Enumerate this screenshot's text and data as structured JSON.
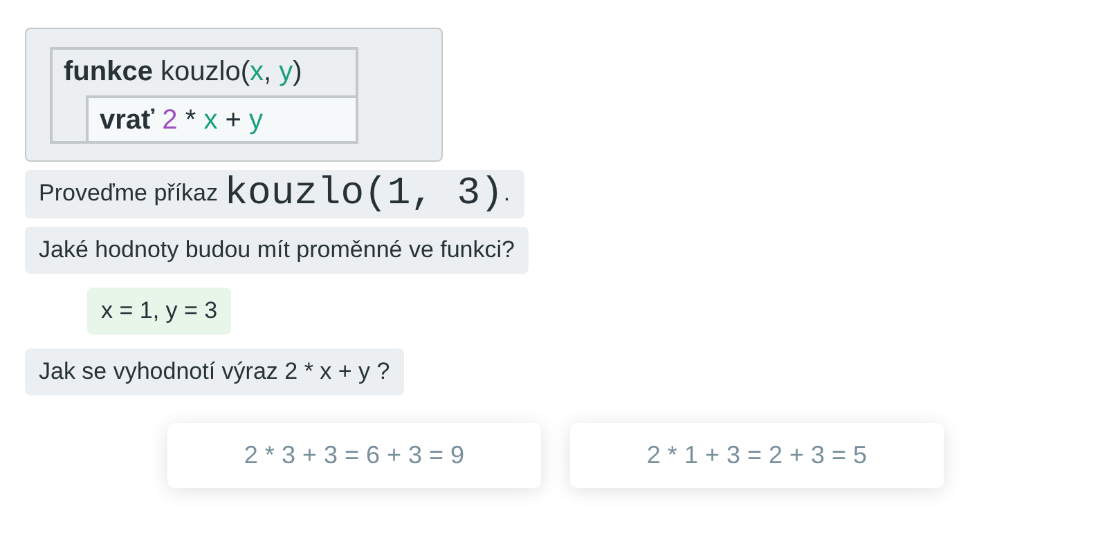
{
  "code_block": {
    "lines": [
      {
        "tokens": [
          {
            "kind": "keyword",
            "text": "funkce"
          },
          {
            "kind": "plain",
            "text": " kouzlo("
          },
          {
            "kind": "variable",
            "text": "x"
          },
          {
            "kind": "plain",
            "text": ", "
          },
          {
            "kind": "variable",
            "text": "y"
          },
          {
            "kind": "plain",
            "text": ")"
          }
        ],
        "children": [
          {
            "tokens": [
              {
                "kind": "keyword",
                "text": "vrať "
              },
              {
                "kind": "number",
                "text": "2"
              },
              {
                "kind": "plain",
                "text": " * "
              },
              {
                "kind": "variable",
                "text": "x"
              },
              {
                "kind": "plain",
                "text": " + "
              },
              {
                "kind": "variable",
                "text": "y"
              }
            ]
          }
        ]
      }
    ]
  },
  "messages": [
    {
      "kind": "question",
      "parts": [
        {
          "kind": "text",
          "text": "Proveďme příkaz "
        },
        {
          "kind": "code",
          "text": "kouzlo(1, 3)"
        },
        {
          "kind": "text",
          "text": "."
        }
      ]
    },
    {
      "kind": "question",
      "parts": [
        {
          "kind": "text",
          "text": "Jaké hodnoty budou mít proměnné ve funkci?"
        }
      ]
    },
    {
      "kind": "answer",
      "parts": [
        {
          "kind": "text",
          "text": "x = 1, y = 3"
        }
      ]
    },
    {
      "kind": "question",
      "parts": [
        {
          "kind": "text",
          "text": "Jak se vyhodnotí výraz 2 * x + y ?"
        }
      ]
    }
  ],
  "choices": [
    "2 * 3 + 3 = 6 + 3 = 9",
    "2 * 1 + 3 = 2 + 3 = 5"
  ]
}
